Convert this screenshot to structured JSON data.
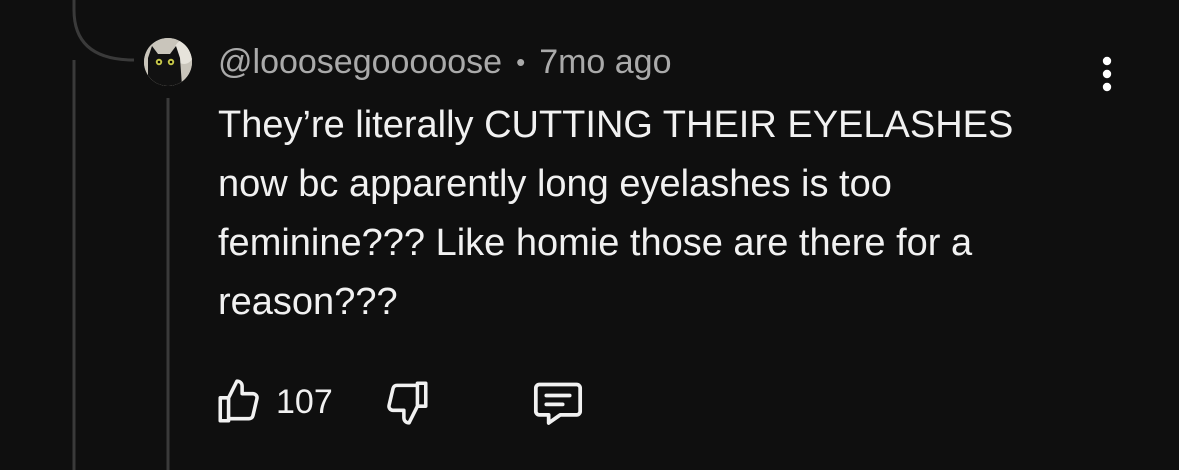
{
  "comment": {
    "author": "@looosegooooose",
    "separator": "•",
    "time": "7mo ago",
    "text": "They’re literally CUTTING THEIR EYELASHES now bc apparently long eyelashes is too feminine??? Like homie those are there for a reason???",
    "like_count": "107"
  },
  "icons": {
    "avatar": "black-cat-avatar",
    "more": "vertical-ellipsis-icon",
    "like": "thumbs-up-icon",
    "dislike": "thumbs-down-icon",
    "reply": "comment-bubble-icon"
  },
  "colors": {
    "background": "#0f0f0f",
    "thread_line": "#3a3a3a",
    "meta_text": "#aaaaaa",
    "body_text": "#f1f1f1"
  }
}
